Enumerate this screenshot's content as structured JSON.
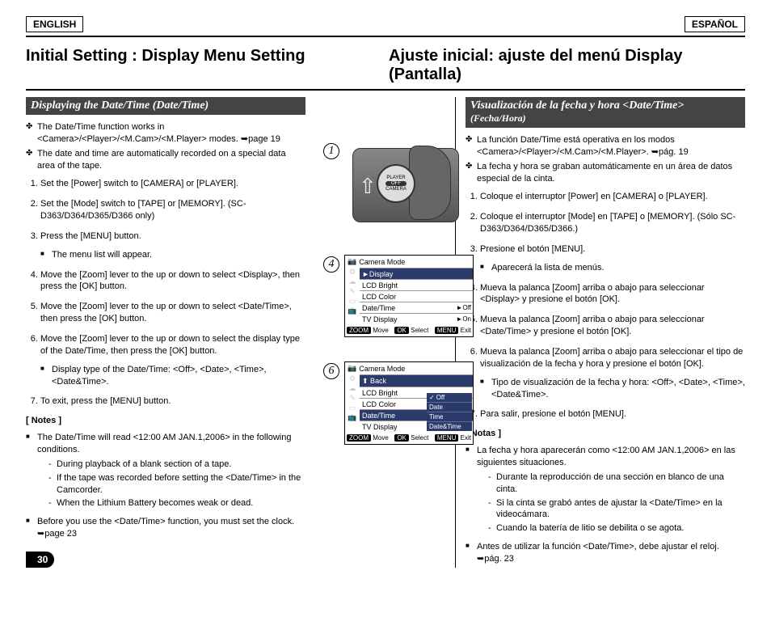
{
  "lang": {
    "en": "ENGLISH",
    "es": "ESPAÑOL"
  },
  "title": {
    "en": "Initial Setting : Display Menu Setting",
    "es": "Ajuste inicial: ajuste del menú Display (Pantalla)"
  },
  "section": {
    "en": "Displaying the Date/Time (Date/Time)",
    "es_a": "Visualización de la fecha y hora <Date/Time>",
    "es_b": " (Fecha/Hora)"
  },
  "en": {
    "b1": "The Date/Time function works in <Camera>/<Player>/<M.Cam>/<M.Player> modes. ➥page 19",
    "b2": "The date and time are automatically recorded on a special data area of the tape.",
    "s1": "Set the [Power] switch to [CAMERA] or [PLAYER].",
    "s2": "Set the [Mode] switch to [TAPE] or [MEMORY]. (SC-D363/D364/D365/D366 only)",
    "s3": "Press the [MENU] button.",
    "s3a": "The menu list will appear.",
    "s4": "Move the [Zoom] lever to the up or down to select <Display>, then press the [OK] button.",
    "s5": "Move the [Zoom] lever to the up or down to select <Date/Time>, then press the [OK] button.",
    "s6": "Move the [Zoom] lever to the up or down to select the display type of the Date/Time, then press the [OK] button.",
    "s6a": "Display type of the Date/Time: <Off>, <Date>, <Time>, <Date&Time>.",
    "s7": "To exit, press the [MENU] button.",
    "notes": "[ Notes ]",
    "n1": "The Date/Time will read <12:00 AM JAN.1,2006> in the following conditions.",
    "n1a": "During playback of a blank section of a tape.",
    "n1b": "If the tape was recorded before setting the <Date/Time> in the Camcorder.",
    "n1c": "When the Lithium Battery becomes weak or dead.",
    "n2": "Before you use the <Date/Time> function, you must set the clock. ➥page 23"
  },
  "es": {
    "b1": "La función Date/Time está operativa en los modos <Camera>/<Player>/<M.Cam>/<M.Player>. ➥pág. 19",
    "b2": "La fecha y hora se graban automáticamente en un área de datos especial de la cinta.",
    "s1": "Coloque el interruptor [Power] en [CAMERA] o [PLAYER].",
    "s2": "Coloque el interruptor [Mode] en [TAPE] o [MEMORY]. (Sólo SC-D363/D364/D365/D366.)",
    "s3": "Presione el botón [MENU].",
    "s3a": "Aparecerá la lista de menús.",
    "s4": "Mueva la palanca [Zoom] arriba o abajo para seleccionar <Display> y presione el botón [OK].",
    "s5": "Mueva la palanca [Zoom] arriba o abajo para seleccionar <Date/Time> y presione el botón [OK].",
    "s6": "Mueva la palanca [Zoom] arriba o abajo para seleccionar el tipo de visualización de la fecha y hora y presione el botón [OK].",
    "s6a": "Tipo de visualización de la fecha y hora: <Off>, <Date>, <Time>, <Date&Time>.",
    "s7": "Para salir, presione el botón [MENU].",
    "notes": "[ Notas ]",
    "n1": "La fecha y hora aparecerán como <12:00 AM JAN.1,2006> en las siguientes situaciones.",
    "n1a": "Durante la reproducción de una sección en blanco de una cinta.",
    "n1b": "Si la cinta se grabó antes de ajustar la <Date/Time> en la videocámara.",
    "n1c": "Cuando la batería de litio se debilita o se agota.",
    "n2": "Antes de utilizar la función <Date/Time>, debe ajustar el reloj. ➥pág. 23"
  },
  "diag": {
    "n1": "1",
    "n4": "4",
    "n6": "6",
    "dial_top": "PLAYER",
    "dial_mid": "OFF",
    "dial_bot": "CAMERA",
    "menu4": {
      "title": "Camera Mode",
      "r0": "►Display",
      "r1": "LCD Bright",
      "r2": "LCD Color",
      "r3": "Date/Time",
      "r4": "TV Display",
      "opt_off": "►Off",
      "opt_on": "►On"
    },
    "menu6": {
      "title": "Camera Mode",
      "back": "Back",
      "r1": "LCD Bright",
      "r2": "LCD Color",
      "r3": "Date/Time",
      "r4": "TV Display",
      "o1": "Off",
      "o2": "Date",
      "o3": "Time",
      "o4": "Date&Time"
    },
    "foot": {
      "zoom": "ZOOM",
      "move": "Move",
      "ok": "OK",
      "select": "Select",
      "menu": "MENU",
      "exit": "Exit"
    }
  },
  "page": "30"
}
